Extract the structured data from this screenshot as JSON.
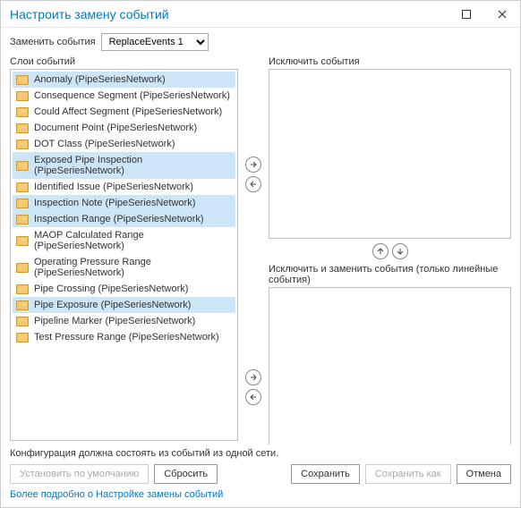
{
  "window": {
    "title": "Настроить замену событий"
  },
  "topbar": {
    "label": "Заменить события",
    "selected": "ReplaceEvents 1"
  },
  "left": {
    "label": "Слои событий",
    "items": [
      {
        "label": "Anomaly (PipeSeriesNetwork)",
        "selected": true
      },
      {
        "label": "Consequence Segment (PipeSeriesNetwork)",
        "selected": false
      },
      {
        "label": "Could Affect Segment (PipeSeriesNetwork)",
        "selected": false
      },
      {
        "label": "Document Point (PipeSeriesNetwork)",
        "selected": false
      },
      {
        "label": "DOT Class (PipeSeriesNetwork)",
        "selected": false
      },
      {
        "label": "Exposed Pipe Inspection (PipeSeriesNetwork)",
        "selected": true
      },
      {
        "label": "Identified Issue (PipeSeriesNetwork)",
        "selected": false
      },
      {
        "label": "Inspection Note (PipeSeriesNetwork)",
        "selected": true
      },
      {
        "label": "Inspection Range (PipeSeriesNetwork)",
        "selected": true
      },
      {
        "label": "MAOP Calculated Range (PipeSeriesNetwork)",
        "selected": false
      },
      {
        "label": "Operating Pressure Range (PipeSeriesNetwork)",
        "selected": false
      },
      {
        "label": "Pipe Crossing (PipeSeriesNetwork)",
        "selected": false
      },
      {
        "label": "Pipe Exposure (PipeSeriesNetwork)",
        "selected": true
      },
      {
        "label": "Pipeline Marker (PipeSeriesNetwork)",
        "selected": false
      },
      {
        "label": "Test Pressure Range (PipeSeriesNetwork)",
        "selected": false
      }
    ]
  },
  "right": {
    "exclude_label": "Исключить события",
    "replace_label": "Исключить и заменить события (только линейные события)"
  },
  "hint": "Конфигурация должна состоять из событий из одной сети.",
  "buttons": {
    "set_default": "Установить по умолчанию",
    "reset": "Сбросить",
    "save": "Сохранить",
    "save_as": "Сохранить как",
    "cancel": "Отмена"
  },
  "help_link": "Более подробно о Настройке замены событий"
}
